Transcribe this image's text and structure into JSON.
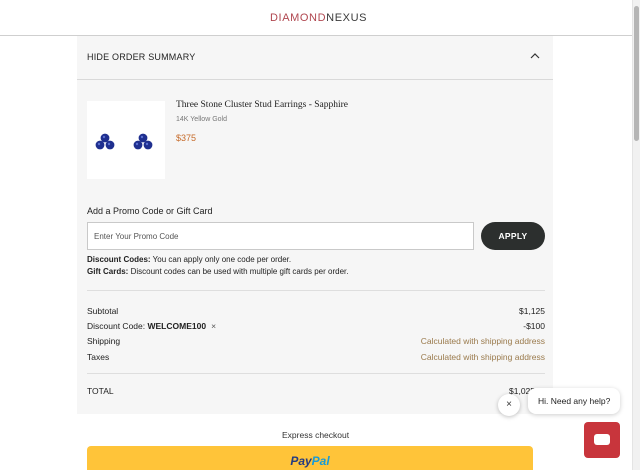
{
  "header": {
    "logo_part1": "DIAMOND",
    "logo_part2": "NEXUS"
  },
  "summary": {
    "toggle_label": "HIDE ORDER SUMMARY"
  },
  "product": {
    "title": "Three Stone Cluster Stud Earrings - Sapphire",
    "variant": "14K Yellow Gold",
    "price": "$375"
  },
  "promo": {
    "label": "Add a Promo Code or Gift Card",
    "placeholder": "Enter Your Promo Code",
    "apply_label": "APPLY",
    "note1_bold": "Discount Codes:",
    "note1_text": " You can apply only one code per order.",
    "note2_bold": "Gift Cards:",
    "note2_text": " Discount codes can be used with multiple gift cards per order."
  },
  "totals": {
    "subtotal_label": "Subtotal",
    "subtotal_value": "$1,125",
    "discount_label": "Discount Code: ",
    "discount_code": "WELCOME100",
    "discount_remove": "×",
    "discount_value": "-$100",
    "shipping_label": "Shipping",
    "shipping_value": "Calculated with shipping address",
    "taxes_label": "Taxes",
    "taxes_value": "Calculated with shipping address",
    "total_label": "TOTAL",
    "total_value": "$1,025"
  },
  "checkout": {
    "express_label": "Express checkout",
    "paypal_part1": "Pay",
    "paypal_part2": "Pal"
  },
  "chat": {
    "close_symbol": "×",
    "bubble_text": "Hi. Need any help?"
  },
  "colors": {
    "brand_red": "#b0464f",
    "price_orange": "#c66b2a",
    "paypal_yellow": "#ffc439",
    "chat_red": "#c8353c",
    "apply_dark": "#2c2f2e"
  },
  "icons": {
    "toggle": "chevron-up-icon",
    "chat": "chat-icon",
    "close": "close-icon"
  }
}
